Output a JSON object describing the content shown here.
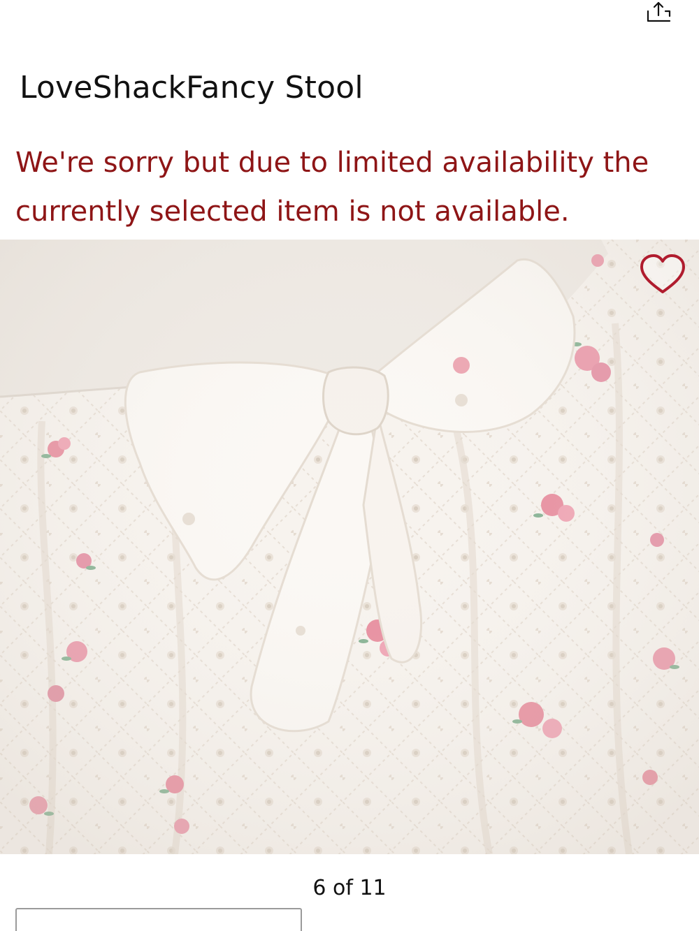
{
  "header": {
    "share_icon": "share-icon"
  },
  "product": {
    "title": "LoveShackFancy Stool",
    "availability_message": "We're sorry but due to limited availability the currently selected item is not available.",
    "favorite_icon": "heart-outline-icon"
  },
  "gallery": {
    "position_label": "6 of 11"
  },
  "colors": {
    "alert_text": "#8e1516",
    "favorite_icon": "#b01c2e",
    "title_text": "#111111"
  }
}
